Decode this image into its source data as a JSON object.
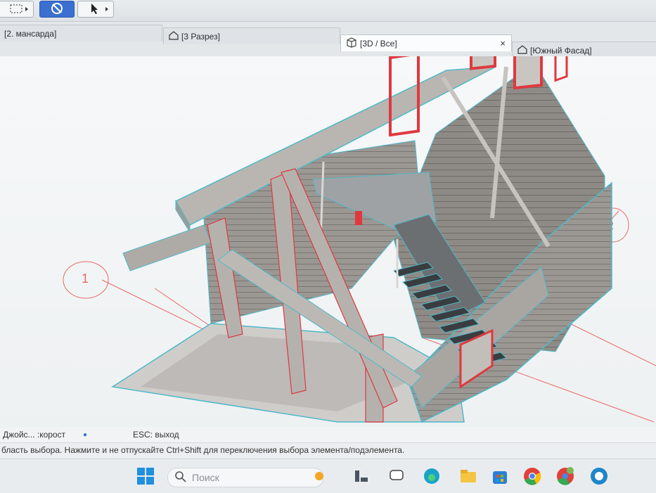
{
  "toolbar": {
    "buttons": [
      {
        "icon": "marquee-select-icon"
      },
      {
        "icon": "orbit-icon",
        "active": true
      },
      {
        "icon": "arrow-pointer-icon"
      }
    ]
  },
  "tabs": [
    {
      "label": "[2. мансарда]",
      "icon": "",
      "active": false
    },
    {
      "label": "[3 Разрез]",
      "icon": "section-house-icon",
      "active": false
    },
    {
      "label": "[3D / Все]",
      "icon": "3d-box-icon",
      "active": true
    },
    {
      "label": "[Южный Фасад]",
      "icon": "elevation-house-icon",
      "active": false
    }
  ],
  "tab_close": "×",
  "viewport": {
    "grid_labels": [
      "1",
      "2"
    ],
    "accent_color": "#e0383e",
    "selection_color": "#4fb8c9"
  },
  "status": {
    "joystick_label": "Джойс... :корост",
    "esc_hint": "ESC: выход",
    "message": "бласть выбора. Нажмите и не отпускайте Ctrl+Shift для переключения выбора элемента/подэлемента."
  },
  "taskbar": {
    "search_placeholder": "Поиск",
    "icons": [
      "windows-start-icon",
      "search-icon",
      "weather-icon",
      "widgets-icon",
      "chat-icon",
      "edge-icon",
      "file-explorer-icon",
      "store-icon",
      "chrome-icon",
      "chrome-profile-icon",
      "app-icon"
    ]
  }
}
